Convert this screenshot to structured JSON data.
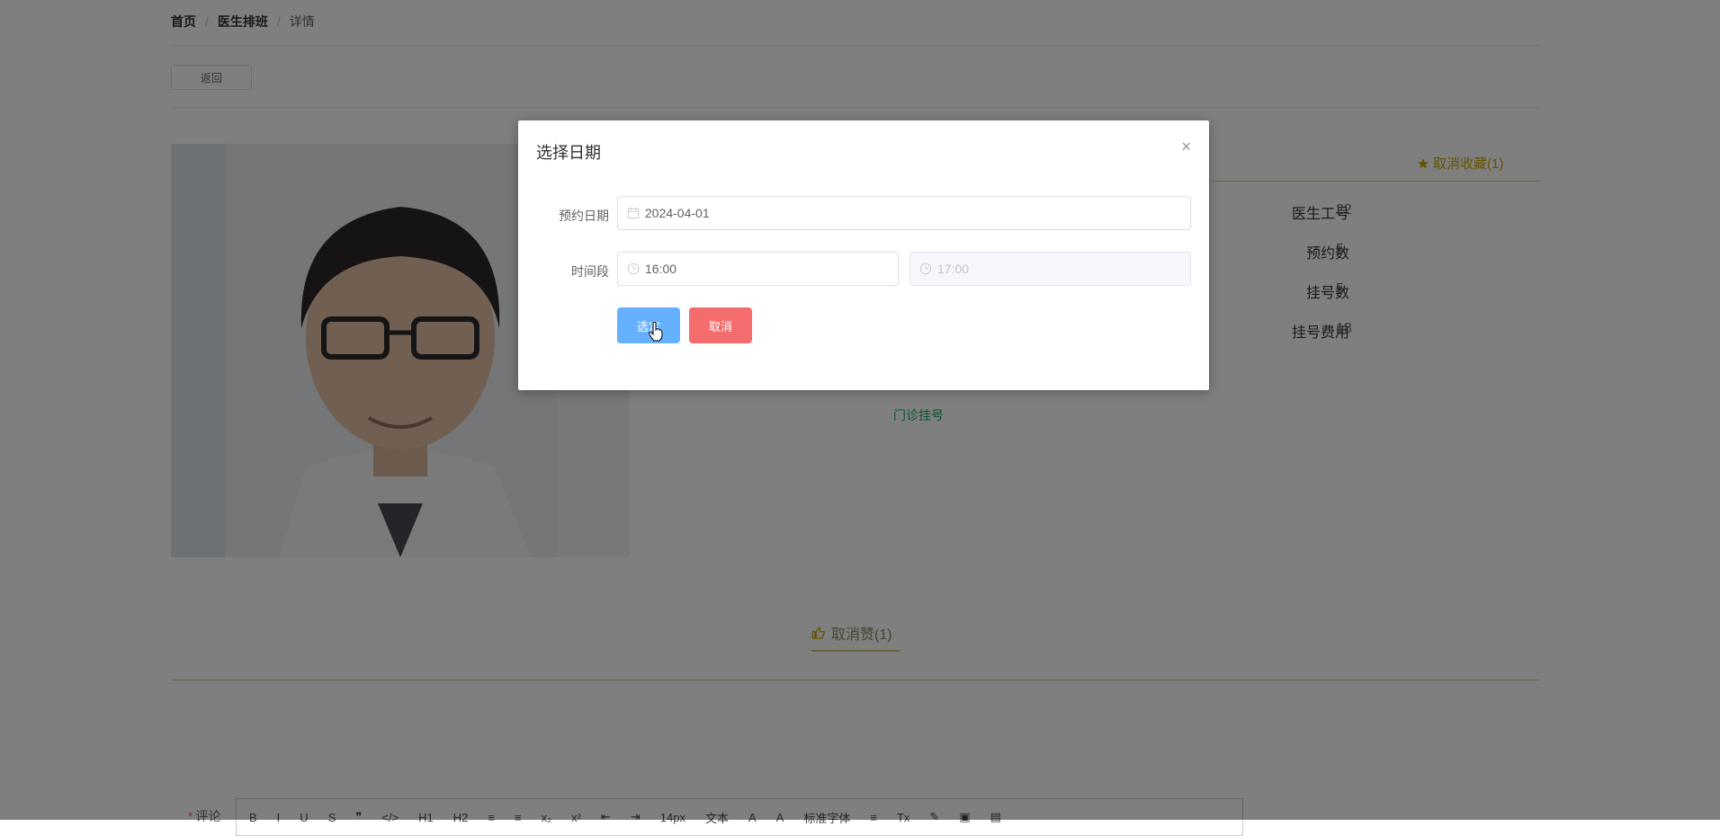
{
  "breadcrumb": {
    "home": "首页",
    "section": "医生排班",
    "current": "详情",
    "separator": "/"
  },
  "back_button": "返回",
  "favorite": {
    "label": "取消收藏(1)",
    "icon": "star-icon"
  },
  "info": [
    {
      "label": "医生工号",
      "value": "22"
    },
    {
      "label": "预约数",
      "value": "5"
    },
    {
      "label": "挂号数",
      "value": "5"
    },
    {
      "label": "挂号费用",
      "value": "18"
    }
  ],
  "appointment_link": "门诊挂号",
  "like": {
    "label": "取消赞(1)",
    "icon": "thumbs-up-icon"
  },
  "comment": {
    "required_mark": "*",
    "label": "评论"
  },
  "toolbar": [
    "B",
    "I",
    "U",
    "S",
    "❞",
    "</>",
    "H1",
    "H2",
    "≡",
    "≡",
    "x₂",
    "x²",
    "⇤",
    "⇥",
    "14px",
    "文本",
    "A",
    "A",
    "标准字体",
    "≡",
    "Tx",
    "✎",
    "▣",
    "▤"
  ],
  "colors": {
    "accent": "#66b1ff",
    "danger": "#f56c6c",
    "favorite": "#c9a800",
    "link": "#1aa260"
  },
  "dialog": {
    "title": "选择日期",
    "close": "×",
    "date_label": "预约日期",
    "date_value": "2024-04-01",
    "time_label": "时间段",
    "time_start": "16:00",
    "time_end": "17:00",
    "ok_button": "选定",
    "cancel_button": "取消"
  }
}
